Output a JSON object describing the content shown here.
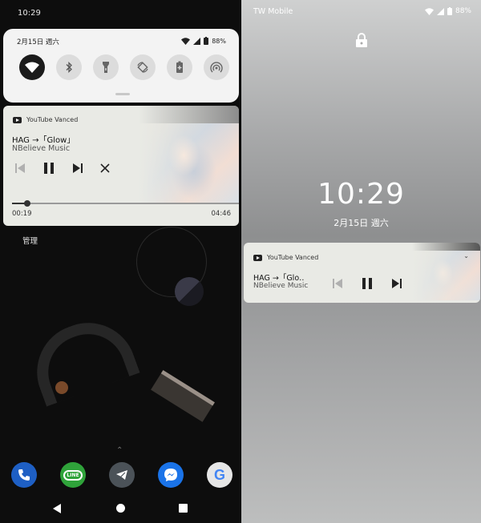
{
  "left": {
    "status_time": "10:29",
    "quick_settings": {
      "date": "2月15日 週六",
      "battery": "88%",
      "tiles": [
        {
          "name": "wifi",
          "on": true
        },
        {
          "name": "bluetooth",
          "on": false
        },
        {
          "name": "flashlight",
          "on": false
        },
        {
          "name": "auto-rotate",
          "on": false
        },
        {
          "name": "battery-saver",
          "on": false
        },
        {
          "name": "hotspot",
          "on": false
        }
      ]
    },
    "notification": {
      "app": "YouTube Vanced",
      "title": "HAG →「Glow」",
      "artist": "NBelieve Music",
      "current_time": "00:19",
      "total_time": "04:46",
      "progress": 0.066
    },
    "manage_label": "管理",
    "dock": [
      {
        "name": "phone",
        "color": "#1e5fc4"
      },
      {
        "name": "line",
        "label": "LINE",
        "color": "#2fa33a"
      },
      {
        "name": "telegram",
        "color": "#4b5258"
      },
      {
        "name": "messenger",
        "color": "#1a73e8"
      },
      {
        "name": "google",
        "label": "G",
        "color": "#e6e6e6"
      }
    ]
  },
  "right": {
    "carrier": "TW Mobile",
    "battery": "88%",
    "clock": "10:29",
    "date": "2月15日 週六",
    "notification": {
      "app": "YouTube Vanced",
      "title": "HAG →「Glo‥",
      "artist": "NBelieve Music"
    }
  }
}
